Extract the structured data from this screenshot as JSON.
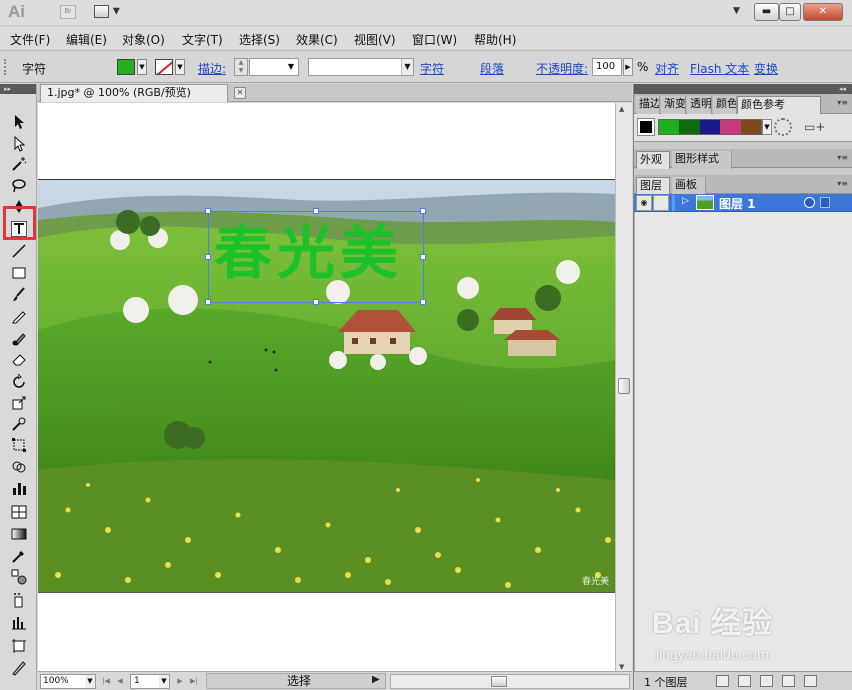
{
  "app": {
    "logo": "Ai",
    "bridge_label": "Br"
  },
  "menu": [
    "文件(F)",
    "编辑(E)",
    "对象(O)",
    "文字(T)",
    "选择(S)",
    "效果(C)",
    "视图(V)",
    "窗口(W)",
    "帮助(H)"
  ],
  "control_bar": {
    "context_label": "字符",
    "fill_color": "#22b022",
    "stroke_label": "描边:",
    "character_link": "字符",
    "paragraph_link": "段落",
    "opacity_label": "不透明度:",
    "opacity_value": "100",
    "opacity_unit": "%",
    "align_link": "对齐",
    "flash_text_link": "Flash 文本",
    "transform_link": "变换"
  },
  "document": {
    "tab_title": "1.jpg* @ 100% (RGB/预览)",
    "headline_text": "春光美",
    "headline_color": "#1bc02a",
    "photo_signature": "春光美"
  },
  "status_bar": {
    "zoom": "100%",
    "page": "1",
    "tool_status": "选择"
  },
  "panels": {
    "guide_tabs": [
      "描边",
      "渐变",
      "透明",
      "颜色",
      "颜色参考"
    ],
    "guide_colors": [
      "#1fae1f",
      "#0d6b0d",
      "#1a1a8a",
      "#c43a7a",
      "#7a4a1a"
    ],
    "appearance_tabs": [
      "外观",
      "图形样式"
    ],
    "layers_tabs": [
      "图层",
      "画板"
    ],
    "layer_name": "图层 1",
    "layer_count": "1 个图层"
  },
  "watermark": {
    "brand": "Bai 经验",
    "url": "jingyan.baidu.com"
  }
}
